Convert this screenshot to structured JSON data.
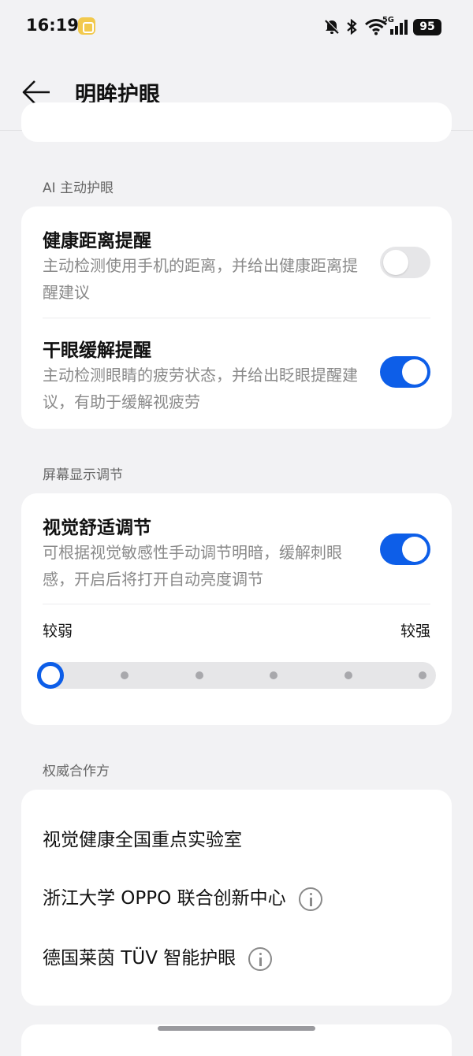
{
  "status_bar": {
    "time": "16:19",
    "battery": "95",
    "signal_label": "5G"
  },
  "header": {
    "title": "明眸护眼"
  },
  "sections": {
    "ai": {
      "label": "AI 主动护眼",
      "items": [
        {
          "title": "健康距离提醒",
          "desc": "主动检测使用手机的距离，并给出健康距离提醒建议",
          "enabled": false
        },
        {
          "title": "干眼缓解提醒",
          "desc": "主动检测眼睛的疲劳状态，并给出眨眼提醒建议，有助于缓解视疲劳",
          "enabled": true
        }
      ]
    },
    "display": {
      "label": "屏幕显示调节",
      "title": "视觉舒适调节",
      "desc": "可根据视觉敏感性手动调节明暗，缓解刺眼感，开启后将打开自动亮度调节",
      "enabled": true,
      "slider": {
        "min_label": "较弱",
        "max_label": "较强",
        "steps": 6,
        "value_index": 0
      }
    },
    "partners": {
      "label": "权威合作方",
      "items": [
        {
          "name": "视觉健康全国重点实验室",
          "has_info": false
        },
        {
          "name": "浙江大学 OPPO 联合创新中心",
          "has_info": true
        },
        {
          "name": "德国莱茵 TÜV 智能护眼",
          "has_info": true
        }
      ]
    }
  },
  "colors": {
    "accent": "#0d5ee8",
    "background": "#f2f2f4",
    "card": "#ffffff"
  }
}
